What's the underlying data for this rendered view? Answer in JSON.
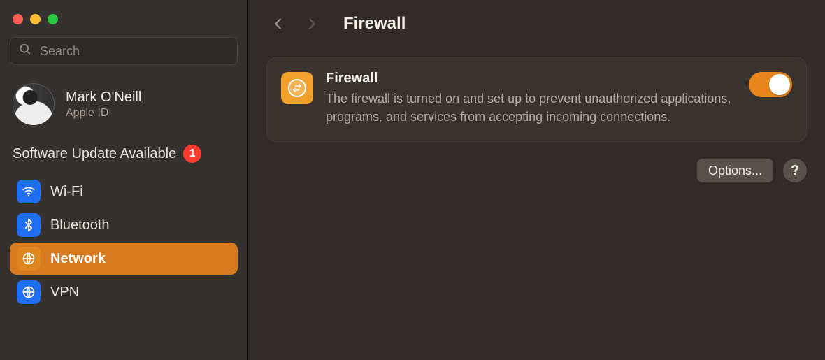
{
  "sidebar": {
    "search_placeholder": "Search",
    "user": {
      "name": "Mark O'Neill",
      "subtitle": "Apple ID"
    },
    "update": {
      "label": "Software Update Available",
      "count": "1"
    },
    "items": [
      {
        "id": "wifi",
        "label": "Wi-Fi",
        "icon": "wifi-icon",
        "color": "blue",
        "active": false
      },
      {
        "id": "bluetooth",
        "label": "Bluetooth",
        "icon": "bluetooth-icon",
        "color": "blue",
        "active": false
      },
      {
        "id": "network",
        "label": "Network",
        "icon": "globe-icon",
        "color": "orange",
        "active": true
      },
      {
        "id": "vpn",
        "label": "VPN",
        "icon": "vpn-icon",
        "color": "blue",
        "active": false
      }
    ]
  },
  "header": {
    "title": "Firewall",
    "back_enabled": true,
    "forward_enabled": false
  },
  "firewall_card": {
    "title": "Firewall",
    "description": "The firewall is turned on and set up to prevent unauthorized applications, programs, and services from accepting incoming connections.",
    "enabled": true
  },
  "actions": {
    "options_label": "Options...",
    "help_label": "?"
  }
}
